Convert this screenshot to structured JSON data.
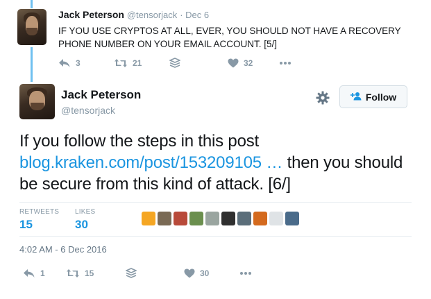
{
  "previous_tweet": {
    "author_name": "Jack Peterson",
    "handle": "@tensorjack",
    "date": "· Dec 6",
    "text": "IF YOU USE CRYPTOS AT ALL, EVER, YOU SHOULD NOT HAVE A RECOVERY PHONE NUMBER ON YOUR EMAIL ACCOUNT. [5/]",
    "reply_count": "3",
    "retweet_count": "21",
    "like_count": "32"
  },
  "main_tweet": {
    "author_name": "Jack Peterson",
    "handle": "@tensorjack",
    "follow_label": "Follow",
    "text_before_link": "If you follow the steps in this post ",
    "link_text": "blog.kraken.com/post/153209105 …",
    "text_after_link": " then you should be secure from this kind of attack. [6/]",
    "stats": {
      "retweets_label": "RETWEETS",
      "retweets_value": "15",
      "likes_label": "LIKES",
      "likes_value": "30"
    },
    "timestamp": "4:02 AM - 6 Dec 2016",
    "reply_count": "1",
    "retweet_count": "15",
    "like_count": "30"
  },
  "liker_avatar_colors": [
    "#f5a623",
    "#7a6a55",
    "#b84a3a",
    "#6b8f4e",
    "#9aa5a0",
    "#2f2f2f",
    "#5b6e7a",
    "#d46a1e",
    "#dfe3e6",
    "#4a6b8a"
  ],
  "colors": {
    "link": "#1b95e0",
    "muted": "#8899a6",
    "thread_line": "#6fc0f0"
  },
  "icons": [
    "reply-icon",
    "retweet-icon",
    "buffer-icon",
    "heart-icon",
    "more-icon",
    "gear-icon",
    "follow-person-icon"
  ]
}
